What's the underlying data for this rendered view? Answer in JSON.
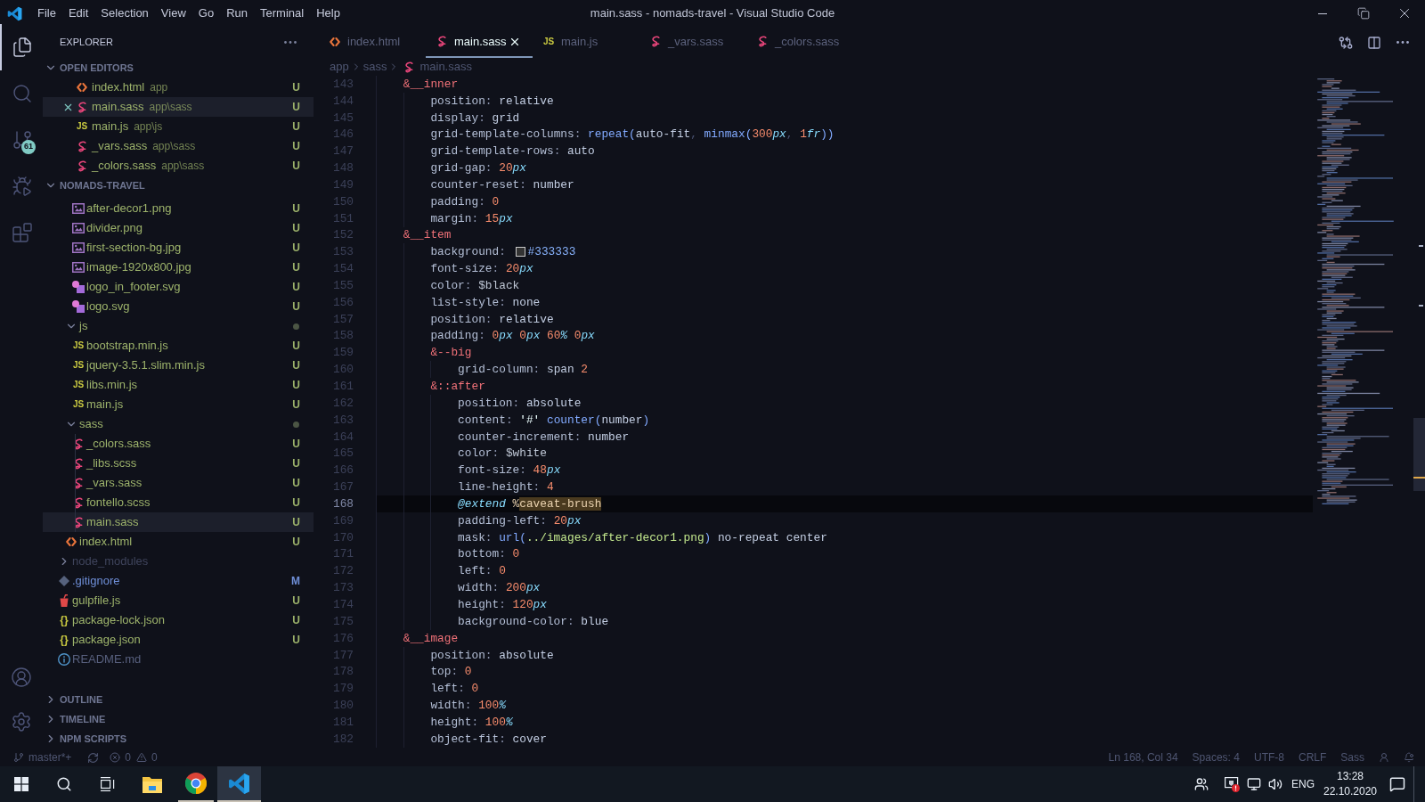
{
  "title_bar": {
    "menu": [
      "File",
      "Edit",
      "Selection",
      "View",
      "Go",
      "Run",
      "Terminal",
      "Help"
    ],
    "title": "main.sass - nomads-travel - Visual Studio Code"
  },
  "activity_bar": {
    "items": [
      {
        "kind": "explorer",
        "selected": true
      },
      {
        "kind": "search",
        "selected": false
      },
      {
        "kind": "source-control",
        "selected": false,
        "badge": "61"
      },
      {
        "kind": "run-debug",
        "selected": false
      },
      {
        "kind": "extensions",
        "selected": false
      }
    ],
    "bottom": [
      {
        "kind": "accounts"
      },
      {
        "kind": "settings"
      }
    ]
  },
  "sidebar": {
    "title": "EXPLORER",
    "open_editors": {
      "title": "OPEN EDITORS",
      "expanded": true,
      "items": [
        {
          "label": "index.html",
          "description": "app",
          "kind": "html",
          "color": "#9db36b",
          "badge": "U",
          "selected": false
        },
        {
          "label": "main.sass",
          "description": "app\\sass",
          "kind": "sass",
          "color": "#9db36b",
          "badge": "U",
          "selected": true
        },
        {
          "label": "main.js",
          "description": "app\\js",
          "kind": "js",
          "icon_label": "JS",
          "color": "#9db36b",
          "badge": "U",
          "selected": false
        },
        {
          "label": "_vars.sass",
          "description": "app\\sass",
          "kind": "sass",
          "color": "#9db36b",
          "badge": "U",
          "selected": false
        },
        {
          "label": "_colors.sass",
          "description": "app\\sass",
          "kind": "sass",
          "color": "#9db36b",
          "badge": "U",
          "selected": false
        }
      ]
    },
    "folder": {
      "title": "NOMADS-TRAVEL",
      "expanded": true,
      "tree": [
        {
          "children": [
            {
              "children": [
                {
                  "label": "after-decor1.png",
                  "kind": "image",
                  "color": "#9db36b",
                  "badge": "U",
                  "selected": false
                },
                {
                  "label": "divider.png",
                  "kind": "image",
                  "color": "#9db36b",
                  "badge": "U",
                  "selected": false
                },
                {
                  "label": "first-section-bg.jpg",
                  "kind": "image",
                  "color": "#9db36b",
                  "badge": "U",
                  "selected": false
                },
                {
                  "label": "image-1920x800.jpg",
                  "kind": "image",
                  "color": "#9db36b",
                  "badge": "U",
                  "selected": false
                },
                {
                  "label": "logo_in_footer.svg",
                  "kind": "svg",
                  "color": "#9db36b",
                  "badge": "U",
                  "selected": false
                },
                {
                  "label": "logo.svg",
                  "kind": "svg",
                  "color": "#9db36b",
                  "badge": "U",
                  "selected": false
                }
              ]
            },
            {
              "label": "js",
              "kind": "folder",
              "expanded": true,
              "color": "#9db36b",
              "dot": true,
              "selected": false,
              "children": [
                {
                  "label": "bootstrap.min.js",
                  "kind": "js",
                  "icon_label": "JS",
                  "color": "#9db36b",
                  "badge": "U",
                  "selected": false
                },
                {
                  "label": "jquery-3.5.1.slim.min.js",
                  "kind": "js",
                  "icon_label": "JS",
                  "color": "#9db36b",
                  "badge": "U",
                  "selected": false
                },
                {
                  "label": "libs.min.js",
                  "kind": "js",
                  "icon_label": "JS",
                  "color": "#9db36b",
                  "badge": "U",
                  "selected": false
                },
                {
                  "label": "main.js",
                  "kind": "js",
                  "icon_label": "JS",
                  "color": "#9db36b",
                  "badge": "U",
                  "selected": false
                }
              ]
            },
            {
              "label": "sass",
              "kind": "folder",
              "expanded": true,
              "color": "#9db36b",
              "dot": true,
              "selected": false,
              "children": [
                {
                  "label": "_colors.sass",
                  "kind": "sass",
                  "color": "#9db36b",
                  "badge": "U",
                  "selected": false
                },
                {
                  "label": "_libs.scss",
                  "kind": "sass",
                  "color": "#9db36b",
                  "badge": "U",
                  "selected": false
                },
                {
                  "label": "_vars.sass",
                  "kind": "sass",
                  "color": "#9db36b",
                  "badge": "U",
                  "selected": false
                },
                {
                  "label": "fontello.scss",
                  "kind": "sass",
                  "color": "#9db36b",
                  "badge": "U",
                  "selected": false
                },
                {
                  "label": "main.sass",
                  "kind": "sass",
                  "color": "#9db36b",
                  "badge": "U",
                  "selected": true
                }
              ]
            },
            {
              "label": "index.html",
              "kind": "html",
              "color": "#9db36b",
              "badge": "U",
              "selected": false
            }
          ]
        },
        {
          "label": "node_modules",
          "kind": "folder",
          "expanded": false,
          "color": "#3f445c",
          "dot": false,
          "selected": false
        },
        {
          "label": ".gitignore",
          "kind": "git",
          "color": "#6f8fd8",
          "badge": "M",
          "selected": false
        },
        {
          "label": "gulpfile.js",
          "kind": "gulp",
          "color": "#9db36b",
          "badge": "U",
          "selected": false
        },
        {
          "label": "package-lock.json",
          "kind": "json",
          "icon_label": "{}",
          "color": "#9db36b",
          "badge": "U",
          "selected": false
        },
        {
          "label": "package.json",
          "kind": "json",
          "icon_label": "{}",
          "color": "#9db36b",
          "badge": "U",
          "selected": false
        },
        {
          "label": "README.md",
          "kind": "info",
          "color": "#58607e",
          "selected": false
        }
      ]
    },
    "panels": [
      {
        "title": "OUTLINE",
        "expanded": false
      },
      {
        "title": "TIMELINE",
        "expanded": false
      },
      {
        "title": "NPM SCRIPTS",
        "expanded": false
      }
    ]
  },
  "editor": {
    "tabs": [
      {
        "label": "index.html",
        "kind": "html",
        "selected": false
      },
      {
        "label": "main.sass",
        "kind": "sass",
        "selected": true
      },
      {
        "label": "main.js",
        "kind": "js",
        "icon_label": "JS",
        "selected": false
      },
      {
        "label": "_vars.sass",
        "kind": "sass",
        "selected": false
      },
      {
        "label": "_colors.sass",
        "kind": "sass",
        "selected": false
      }
    ],
    "breadcrumb": [
      {
        "label": "app",
        "kind": "folder"
      },
      {
        "label": "sass",
        "kind": "folder"
      },
      {
        "label": "main.sass",
        "kind": "sass"
      }
    ],
    "lines": [
      {
        "children": [
          {
            "number": "143",
            "current": false,
            "tokens": [
              {
                "kind": "selector",
                "text": "&__inner"
              }
            ],
            "children": [
              {
                "number": "144",
                "current": false,
                "tokens": [
                  {
                    "kind": "property",
                    "text": "position"
                  },
                  {
                    "kind": "punct",
                    "text": ": "
                  },
                  {
                    "kind": "value",
                    "text": "relative"
                  }
                ]
              },
              {
                "number": "145",
                "current": false,
                "tokens": [
                  {
                    "kind": "property",
                    "text": "display"
                  },
                  {
                    "kind": "punct",
                    "text": ": "
                  },
                  {
                    "kind": "value",
                    "text": "grid"
                  }
                ]
              },
              {
                "number": "146",
                "current": false,
                "tokens": [
                  {
                    "kind": "property",
                    "text": "grid-template-columns"
                  },
                  {
                    "kind": "punct",
                    "text": ": "
                  },
                  {
                    "kind": "function",
                    "text": "repeat("
                  },
                  {
                    "kind": "value",
                    "text": "auto-fit"
                  },
                  {
                    "kind": "comma",
                    "text": ", "
                  },
                  {
                    "kind": "function",
                    "text": "minmax("
                  },
                  {
                    "kind": "number",
                    "text": "300"
                  },
                  {
                    "kind": "unit",
                    "text": "px"
                  },
                  {
                    "kind": "comma",
                    "text": ", "
                  },
                  {
                    "kind": "number",
                    "text": "1"
                  },
                  {
                    "kind": "unit",
                    "text": "fr"
                  },
                  {
                    "kind": "function",
                    "text": "))"
                  }
                ]
              },
              {
                "number": "147",
                "current": false,
                "tokens": [
                  {
                    "kind": "property",
                    "text": "grid-template-rows"
                  },
                  {
                    "kind": "punct",
                    "text": ": "
                  },
                  {
                    "kind": "value",
                    "text": "auto"
                  }
                ]
              },
              {
                "number": "148",
                "current": false,
                "tokens": [
                  {
                    "kind": "property",
                    "text": "grid-gap"
                  },
                  {
                    "kind": "punct",
                    "text": ": "
                  },
                  {
                    "kind": "number",
                    "text": "20"
                  },
                  {
                    "kind": "unit",
                    "text": "px"
                  }
                ]
              },
              {
                "number": "149",
                "current": false,
                "tokens": [
                  {
                    "kind": "property",
                    "text": "counter-reset"
                  },
                  {
                    "kind": "punct",
                    "text": ": "
                  },
                  {
                    "kind": "value",
                    "text": "number"
                  }
                ]
              },
              {
                "number": "150",
                "current": false,
                "tokens": [
                  {
                    "kind": "property",
                    "text": "padding"
                  },
                  {
                    "kind": "punct",
                    "text": ": "
                  },
                  {
                    "kind": "number",
                    "text": "0"
                  }
                ]
              },
              {
                "number": "151",
                "current": false,
                "tokens": [
                  {
                    "kind": "property",
                    "text": "margin"
                  },
                  {
                    "kind": "punct",
                    "text": ": "
                  },
                  {
                    "kind": "number",
                    "text": "15"
                  },
                  {
                    "kind": "unit",
                    "text": "px"
                  }
                ]
              }
            ]
          },
          {
            "number": "152",
            "current": false,
            "tokens": [
              {
                "kind": "selector",
                "text": "&__item"
              }
            ],
            "children": [
              {
                "number": "153",
                "current": false,
                "tokens": [
                  {
                    "kind": "property",
                    "text": "background"
                  },
                  {
                    "kind": "punct",
                    "text": ": "
                  },
                  {
                    "kind": "swatch",
                    "color": "#333333"
                  },
                  {
                    "kind": "hex",
                    "text": "#333333"
                  }
                ]
              },
              {
                "number": "154",
                "current": false,
                "tokens": [
                  {
                    "kind": "property",
                    "text": "font-size"
                  },
                  {
                    "kind": "punct",
                    "text": ": "
                  },
                  {
                    "kind": "number",
                    "text": "20"
                  },
                  {
                    "kind": "unit",
                    "text": "px"
                  }
                ]
              },
              {
                "number": "155",
                "current": false,
                "tokens": [
                  {
                    "kind": "property",
                    "text": "color"
                  },
                  {
                    "kind": "punct",
                    "text": ": "
                  },
                  {
                    "kind": "variable",
                    "text": "$black"
                  }
                ]
              },
              {
                "number": "156",
                "current": false,
                "tokens": [
                  {
                    "kind": "property",
                    "text": "list-style"
                  },
                  {
                    "kind": "punct",
                    "text": ": "
                  },
                  {
                    "kind": "value",
                    "text": "none"
                  }
                ]
              },
              {
                "number": "157",
                "current": false,
                "tokens": [
                  {
                    "kind": "property",
                    "text": "position"
                  },
                  {
                    "kind": "punct",
                    "text": ": "
                  },
                  {
                    "kind": "value",
                    "text": "relative"
                  }
                ]
              },
              {
                "number": "158",
                "current": false,
                "tokens": [
                  {
                    "kind": "property",
                    "text": "padding"
                  },
                  {
                    "kind": "punct",
                    "text": ": "
                  },
                  {
                    "kind": "number",
                    "text": "0"
                  },
                  {
                    "kind": "unit",
                    "text": "px "
                  },
                  {
                    "kind": "number",
                    "text": "0"
                  },
                  {
                    "kind": "unit",
                    "text": "px "
                  },
                  {
                    "kind": "number",
                    "text": "60"
                  },
                  {
                    "kind": "unit",
                    "text": "% "
                  },
                  {
                    "kind": "number",
                    "text": "0"
                  },
                  {
                    "kind": "unit",
                    "text": "px"
                  }
                ]
              },
              {
                "number": "159",
                "current": false,
                "tokens": [
                  {
                    "kind": "selector",
                    "text": "&--big"
                  }
                ],
                "children": [
                  {
                    "number": "160",
                    "current": false,
                    "tokens": [
                      {
                        "kind": "property",
                        "text": "grid-column"
                      },
                      {
                        "kind": "punct",
                        "text": ": "
                      },
                      {
                        "kind": "value",
                        "text": "span "
                      },
                      {
                        "kind": "number",
                        "text": "2"
                      }
                    ]
                  }
                ]
              },
              {
                "number": "161",
                "current": false,
                "tokens": [
                  {
                    "kind": "selector",
                    "text": "&::after"
                  }
                ],
                "children": [
                  {
                    "number": "162",
                    "current": false,
                    "tokens": [
                      {
                        "kind": "property",
                        "text": "position"
                      },
                      {
                        "kind": "punct",
                        "text": ": "
                      },
                      {
                        "kind": "value",
                        "text": "absolute"
                      }
                    ]
                  },
                  {
                    "number": "163",
                    "current": false,
                    "tokens": [
                      {
                        "kind": "property",
                        "text": "content"
                      },
                      {
                        "kind": "punct",
                        "text": ": "
                      },
                      {
                        "kind": "string",
                        "text": "'#' "
                      },
                      {
                        "kind": "function",
                        "text": "counter("
                      },
                      {
                        "kind": "value",
                        "text": "number"
                      },
                      {
                        "kind": "function",
                        "text": ")"
                      }
                    ]
                  },
                  {
                    "number": "164",
                    "current": false,
                    "tokens": [
                      {
                        "kind": "property",
                        "text": "counter-increment"
                      },
                      {
                        "kind": "punct",
                        "text": ": "
                      },
                      {
                        "kind": "value",
                        "text": "number"
                      }
                    ]
                  },
                  {
                    "number": "165",
                    "current": false,
                    "tokens": [
                      {
                        "kind": "property",
                        "text": "color"
                      },
                      {
                        "kind": "punct",
                        "text": ": "
                      },
                      {
                        "kind": "variable",
                        "text": "$white"
                      }
                    ]
                  },
                  {
                    "number": "166",
                    "current": false,
                    "tokens": [
                      {
                        "kind": "property",
                        "text": "font-size"
                      },
                      {
                        "kind": "punct",
                        "text": ": "
                      },
                      {
                        "kind": "number",
                        "text": "48"
                      },
                      {
                        "kind": "unit",
                        "text": "px"
                      }
                    ]
                  },
                  {
                    "number": "167",
                    "current": false,
                    "tokens": [
                      {
                        "kind": "property",
                        "text": "line-height"
                      },
                      {
                        "kind": "punct",
                        "text": ": "
                      },
                      {
                        "kind": "number",
                        "text": "4"
                      }
                    ]
                  },
                  {
                    "number": "168",
                    "current": true,
                    "tokens": [
                      {
                        "kind": "at-rule",
                        "text": "@extend "
                      },
                      {
                        "kind": "placeholder",
                        "text": "%"
                      },
                      {
                        "kind": "highlight",
                        "text": "caveat-brush"
                      }
                    ]
                  },
                  {
                    "number": "169",
                    "current": false,
                    "tokens": [
                      {
                        "kind": "property",
                        "text": "padding-left"
                      },
                      {
                        "kind": "punct",
                        "text": ": "
                      },
                      {
                        "kind": "number",
                        "text": "20"
                      },
                      {
                        "kind": "unit",
                        "text": "px"
                      }
                    ]
                  },
                  {
                    "number": "170",
                    "current": false,
                    "tokens": [
                      {
                        "kind": "property",
                        "text": "mask"
                      },
                      {
                        "kind": "punct",
                        "text": ": "
                      },
                      {
                        "kind": "function",
                        "text": "url("
                      },
                      {
                        "kind": "path",
                        "text": "../images/after-decor1.png"
                      },
                      {
                        "kind": "function",
                        "text": ") "
                      },
                      {
                        "kind": "value",
                        "text": "no-repeat center"
                      }
                    ]
                  },
                  {
                    "number": "171",
                    "current": false,
                    "tokens": [
                      {
                        "kind": "property",
                        "text": "bottom"
                      },
                      {
                        "kind": "punct",
                        "text": ": "
                      },
                      {
                        "kind": "number",
                        "text": "0"
                      }
                    ]
                  },
                  {
                    "number": "172",
                    "current": false,
                    "tokens": [
                      {
                        "kind": "property",
                        "text": "left"
                      },
                      {
                        "kind": "punct",
                        "text": ": "
                      },
                      {
                        "kind": "number",
                        "text": "0"
                      }
                    ]
                  },
                  {
                    "number": "173",
                    "current": false,
                    "tokens": [
                      {
                        "kind": "property",
                        "text": "width"
                      },
                      {
                        "kind": "punct",
                        "text": ": "
                      },
                      {
                        "kind": "number",
                        "text": "200"
                      },
                      {
                        "kind": "unit",
                        "text": "px"
                      }
                    ]
                  },
                  {
                    "number": "174",
                    "current": false,
                    "tokens": [
                      {
                        "kind": "property",
                        "text": "height"
                      },
                      {
                        "kind": "punct",
                        "text": ": "
                      },
                      {
                        "kind": "number",
                        "text": "120"
                      },
                      {
                        "kind": "unit",
                        "text": "px"
                      }
                    ]
                  },
                  {
                    "number": "175",
                    "current": false,
                    "tokens": [
                      {
                        "kind": "property",
                        "text": "background-color"
                      },
                      {
                        "kind": "punct",
                        "text": ": "
                      },
                      {
                        "kind": "value",
                        "text": "blue"
                      }
                    ]
                  }
                ]
              }
            ]
          },
          {
            "number": "176",
            "current": false,
            "tokens": [
              {
                "kind": "selector",
                "text": "&__image"
              }
            ],
            "children": [
              {
                "number": "177",
                "current": false,
                "tokens": [
                  {
                    "kind": "property",
                    "text": "position"
                  },
                  {
                    "kind": "punct",
                    "text": ": "
                  },
                  {
                    "kind": "value",
                    "text": "absolute"
                  }
                ]
              },
              {
                "number": "178",
                "current": false,
                "tokens": [
                  {
                    "kind": "property",
                    "text": "top"
                  },
                  {
                    "kind": "punct",
                    "text": ": "
                  },
                  {
                    "kind": "number",
                    "text": "0"
                  }
                ]
              },
              {
                "number": "179",
                "current": false,
                "tokens": [
                  {
                    "kind": "property",
                    "text": "left"
                  },
                  {
                    "kind": "punct",
                    "text": ": "
                  },
                  {
                    "kind": "number",
                    "text": "0"
                  }
                ]
              },
              {
                "number": "180",
                "current": false,
                "tokens": [
                  {
                    "kind": "property",
                    "text": "width"
                  },
                  {
                    "kind": "punct",
                    "text": ": "
                  },
                  {
                    "kind": "number",
                    "text": "100"
                  },
                  {
                    "kind": "unit",
                    "text": "%"
                  }
                ]
              },
              {
                "number": "181",
                "current": false,
                "tokens": [
                  {
                    "kind": "property",
                    "text": "height"
                  },
                  {
                    "kind": "punct",
                    "text": ": "
                  },
                  {
                    "kind": "number",
                    "text": "100"
                  },
                  {
                    "kind": "unit",
                    "text": "%"
                  }
                ]
              },
              {
                "number": "182",
                "current": false,
                "tokens": [
                  {
                    "kind": "property",
                    "text": "object-fit"
                  },
                  {
                    "kind": "punct",
                    "text": ": "
                  },
                  {
                    "kind": "value",
                    "text": "cover"
                  }
                ]
              }
            ]
          }
        ]
      }
    ]
  },
  "status_bar": {
    "branch": "master*+",
    "errors": "0",
    "warnings": "0",
    "items": [
      "Ln 168, Col 34",
      "Spaces: 4",
      "UTF-8",
      "CRLF",
      "Sass"
    ]
  },
  "taskbar": {
    "apps": [
      {
        "kind": "file-explorer",
        "running": false,
        "selected": false
      },
      {
        "kind": "browser",
        "running": true,
        "selected": false
      },
      {
        "kind": "code-editor",
        "running": true,
        "selected": true
      }
    ],
    "language": "ENG",
    "time": "13:28",
    "date": "22.10.2020"
  }
}
